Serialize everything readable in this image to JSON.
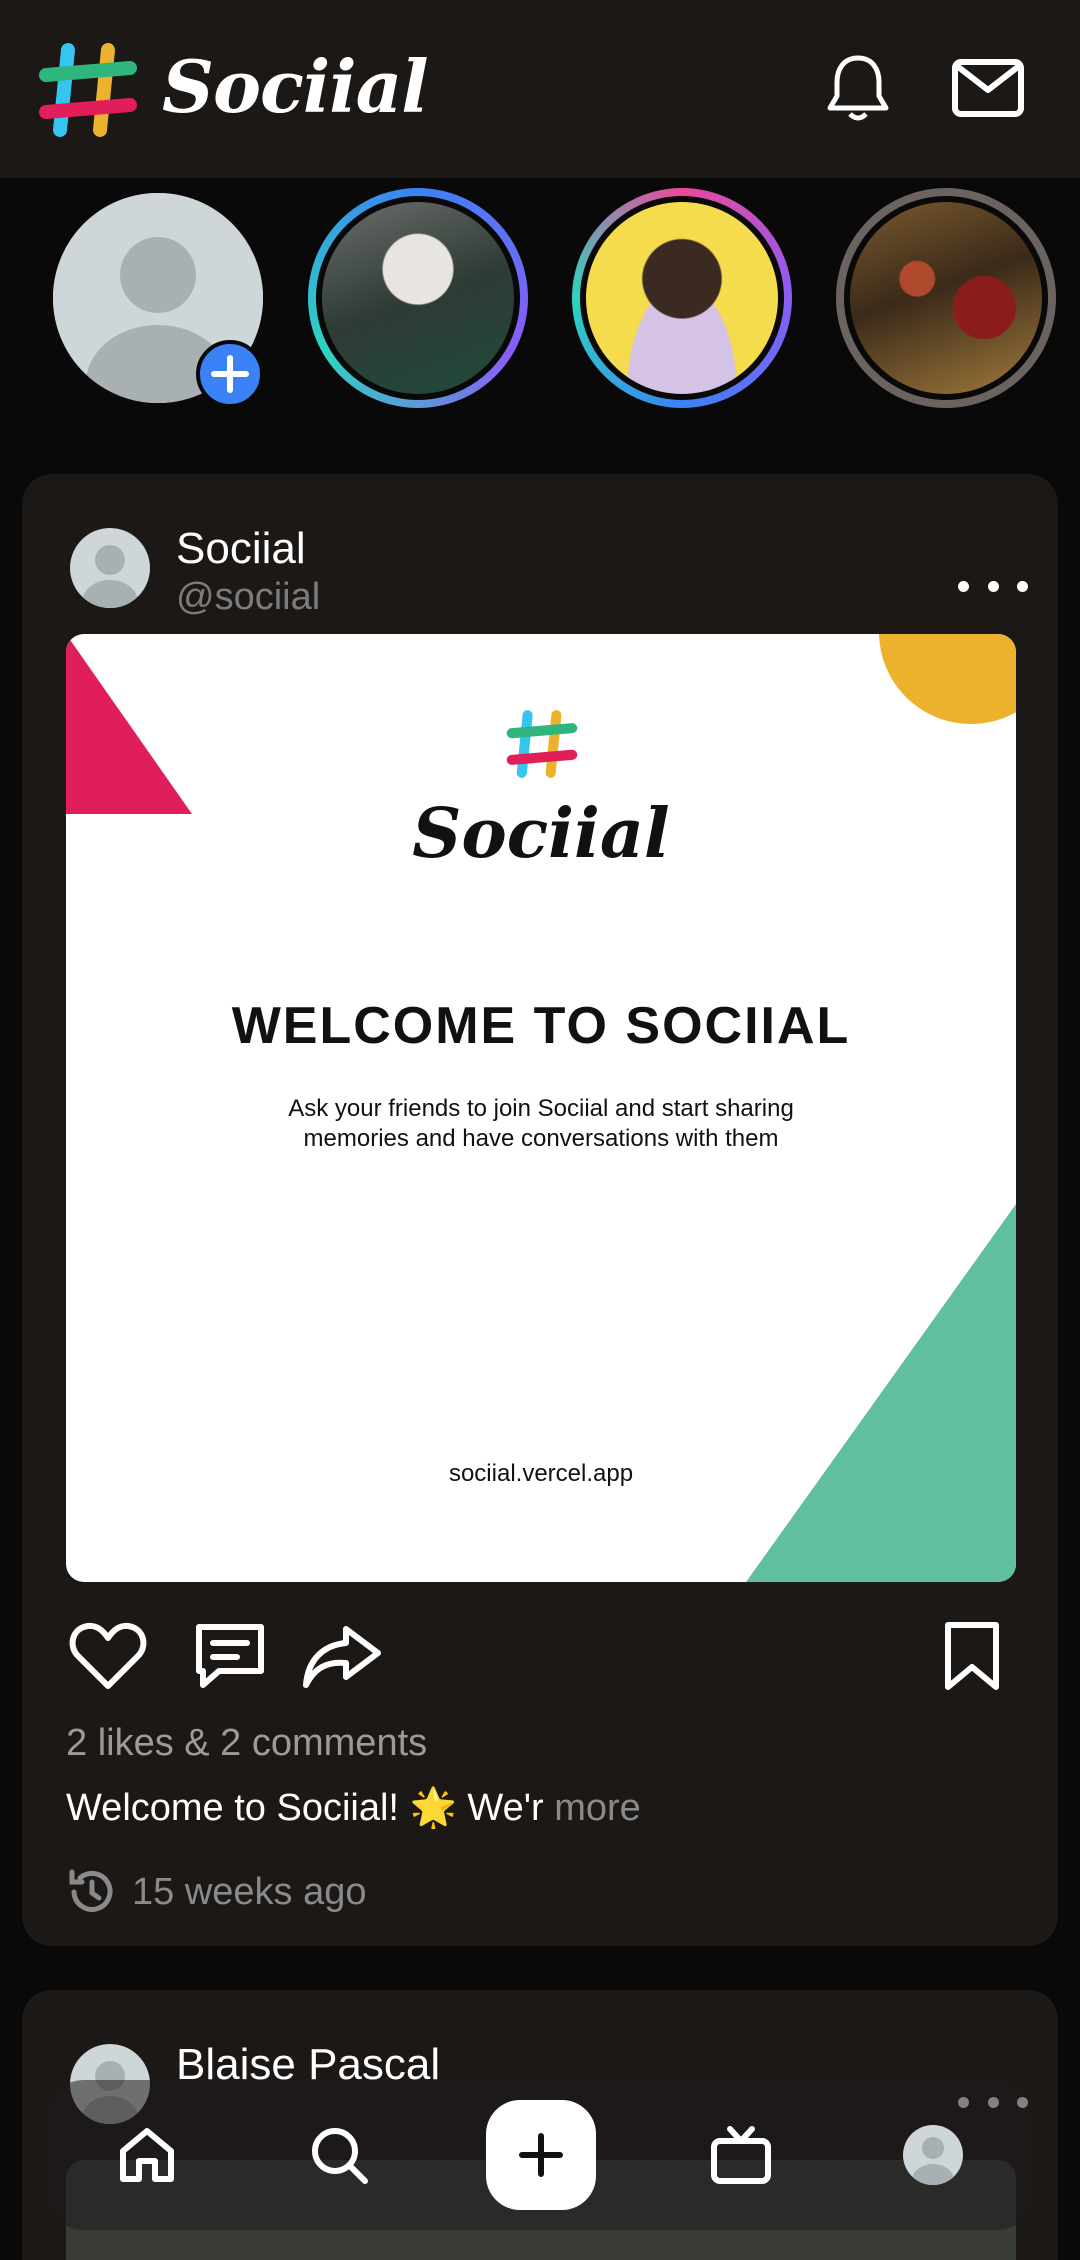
{
  "app": {
    "name": "Sociial"
  },
  "header": {
    "icons": [
      "bell-icon",
      "mail-icon"
    ]
  },
  "stories": [
    {
      "type": "add-story",
      "icon": "add-icon"
    },
    {
      "type": "story",
      "ring": "gradient"
    },
    {
      "type": "story",
      "ring": "gradient"
    },
    {
      "type": "story",
      "ring": "seen"
    }
  ],
  "post1": {
    "author": "Sociial",
    "handle": "@sociial",
    "image": {
      "brand": "Sociial",
      "title": "WELCOME TO SOCIIAL",
      "subtitle": "Ask your friends to join Sociial and start sharing\nmemories and have conversations with them",
      "url": "sociial.vercel.app"
    },
    "stats": "2 likes & 2 comments",
    "caption": "Welcome to Sociial! 🌟 We'r",
    "more": "more",
    "time": "15 weeks ago"
  },
  "post2": {
    "author": "Blaise Pascal"
  },
  "nav": [
    "home-icon",
    "search-icon",
    "plus-icon",
    "tv-icon",
    "profile-icon"
  ],
  "colors": {
    "accent": "#3b82f6",
    "brand_red": "#e11d58",
    "brand_yellow": "#ecb22e",
    "brand_green": "#5fbf9f",
    "brand_blue": "#36c5f0"
  }
}
